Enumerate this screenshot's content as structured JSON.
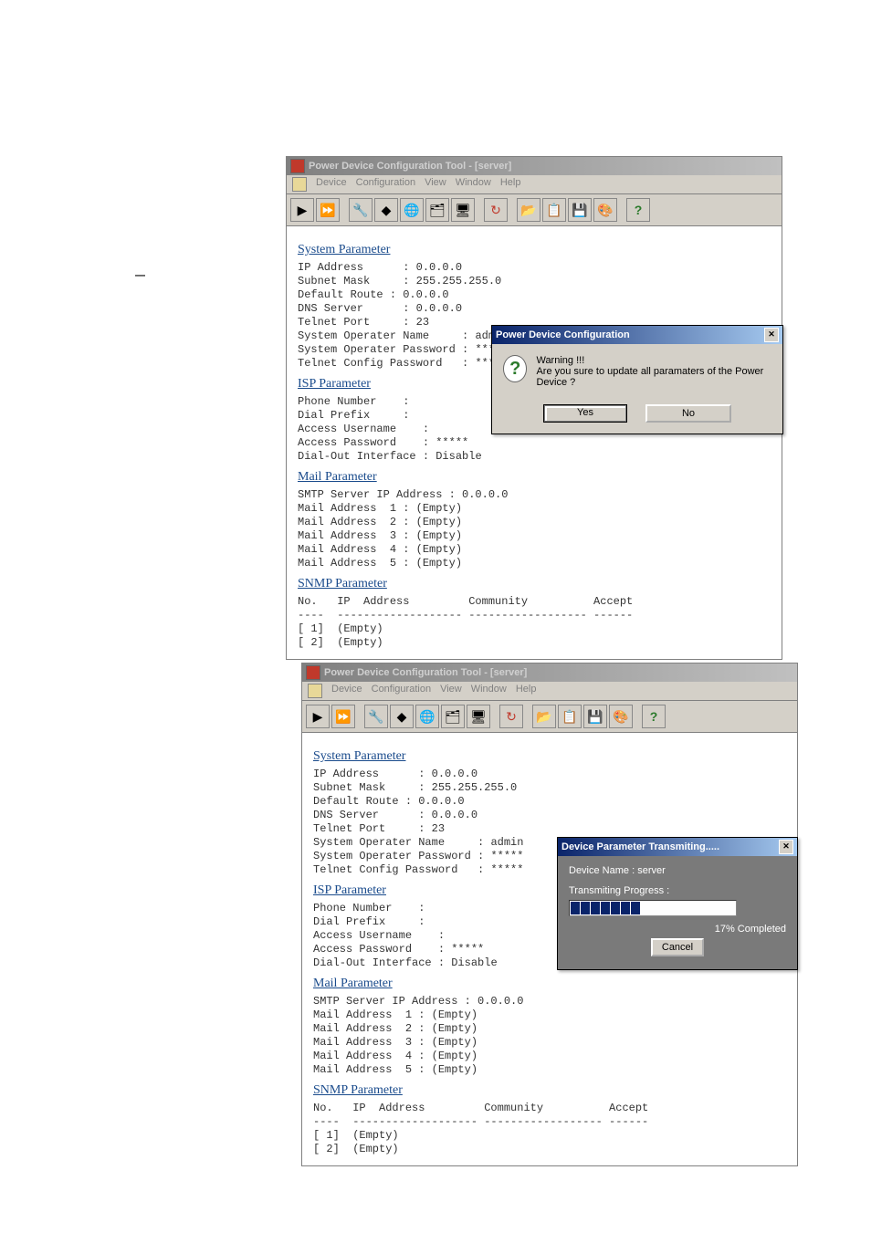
{
  "windows": {
    "w1": {
      "title": "Power Device Configuration Tool - [server]",
      "menubar": [
        "Device",
        "Configuration",
        "View",
        "Window",
        "Help"
      ]
    },
    "w2": {
      "title": "Power Device Configuration Tool - [server]",
      "menubar": [
        "Device",
        "Configuration",
        "View",
        "Window",
        "Help"
      ]
    }
  },
  "toolbar_icons": {
    "i1": "▶",
    "i2": "⏩",
    "i3": "🔧",
    "i4": "◆",
    "i5": "🌐",
    "i6": "🗂",
    "i7": "🖥",
    "i8": "↻",
    "i9": "📂",
    "i10": "📋",
    "i11": "💾",
    "i12": "🎨",
    "i13": "?"
  },
  "sections": {
    "system": "System Parameter",
    "isp": "ISP Parameter",
    "mail": "Mail Parameter",
    "snmp": "SNMP Parameter"
  },
  "sys": {
    "ip_label": "IP Address      : ",
    "ip": "0.0.0.0",
    "subnet_label": "Subnet Mask     : ",
    "subnet": "255.255.255.0",
    "route_label": "Default Route : ",
    "route": "0.0.0.0",
    "dns_label": "DNS Server      : ",
    "dns": "0.0.0.0",
    "telnet_label": "Telnet Port     : ",
    "telnet": "23",
    "opname_label": "System Operater Name     : ",
    "opname": "admin",
    "oppass_label": "System Operater Password : ",
    "oppass": "*****",
    "telpass_label": "Telnet Config Password   : ",
    "telpass": "*****"
  },
  "isp": {
    "phone_label": "Phone Number    : ",
    "phone": "",
    "prefix_label": "Dial Prefix     : ",
    "prefix": "",
    "user_label": "Access Username    : ",
    "user": "",
    "pass_label": "Access Password    : ",
    "pass": "*****",
    "dial_label": "Dial-Out Interface : ",
    "dial": "Disable"
  },
  "mail": {
    "smtp_label": "SMTP Server IP Address : ",
    "smtp": "0.0.0.0",
    "a1_label": "Mail Address  1 : ",
    "a1": "(Empty)",
    "a2_label": "Mail Address  2 : ",
    "a2": "(Empty)",
    "a3_label": "Mail Address  3 : ",
    "a3": "(Empty)",
    "a4_label": "Mail Address  4 : ",
    "a4": "(Empty)",
    "a5_label": "Mail Address  5 : ",
    "a5": "(Empty)"
  },
  "snmp": {
    "header": "No.   IP  Address         Community          Accept",
    "divider": "----  ------------------- ------------------ ------",
    "r1": "[ 1]  (Empty)",
    "r2": "[ 2]  (Empty)"
  },
  "confirm_dialog": {
    "title": "Power Device Configuration",
    "warning": "Warning !!!",
    "message": "Are you sure to update all paramaters of the Power Device ?",
    "yes": "Yes",
    "no": "No"
  },
  "progress_dialog": {
    "title": "Device Parameter Transmiting.....",
    "device_label": "Device Name :   ",
    "device_name": "server",
    "progress_label": "Transmiting Progress :",
    "percent": "17% Completed",
    "cancel": "Cancel"
  },
  "dash": "—"
}
